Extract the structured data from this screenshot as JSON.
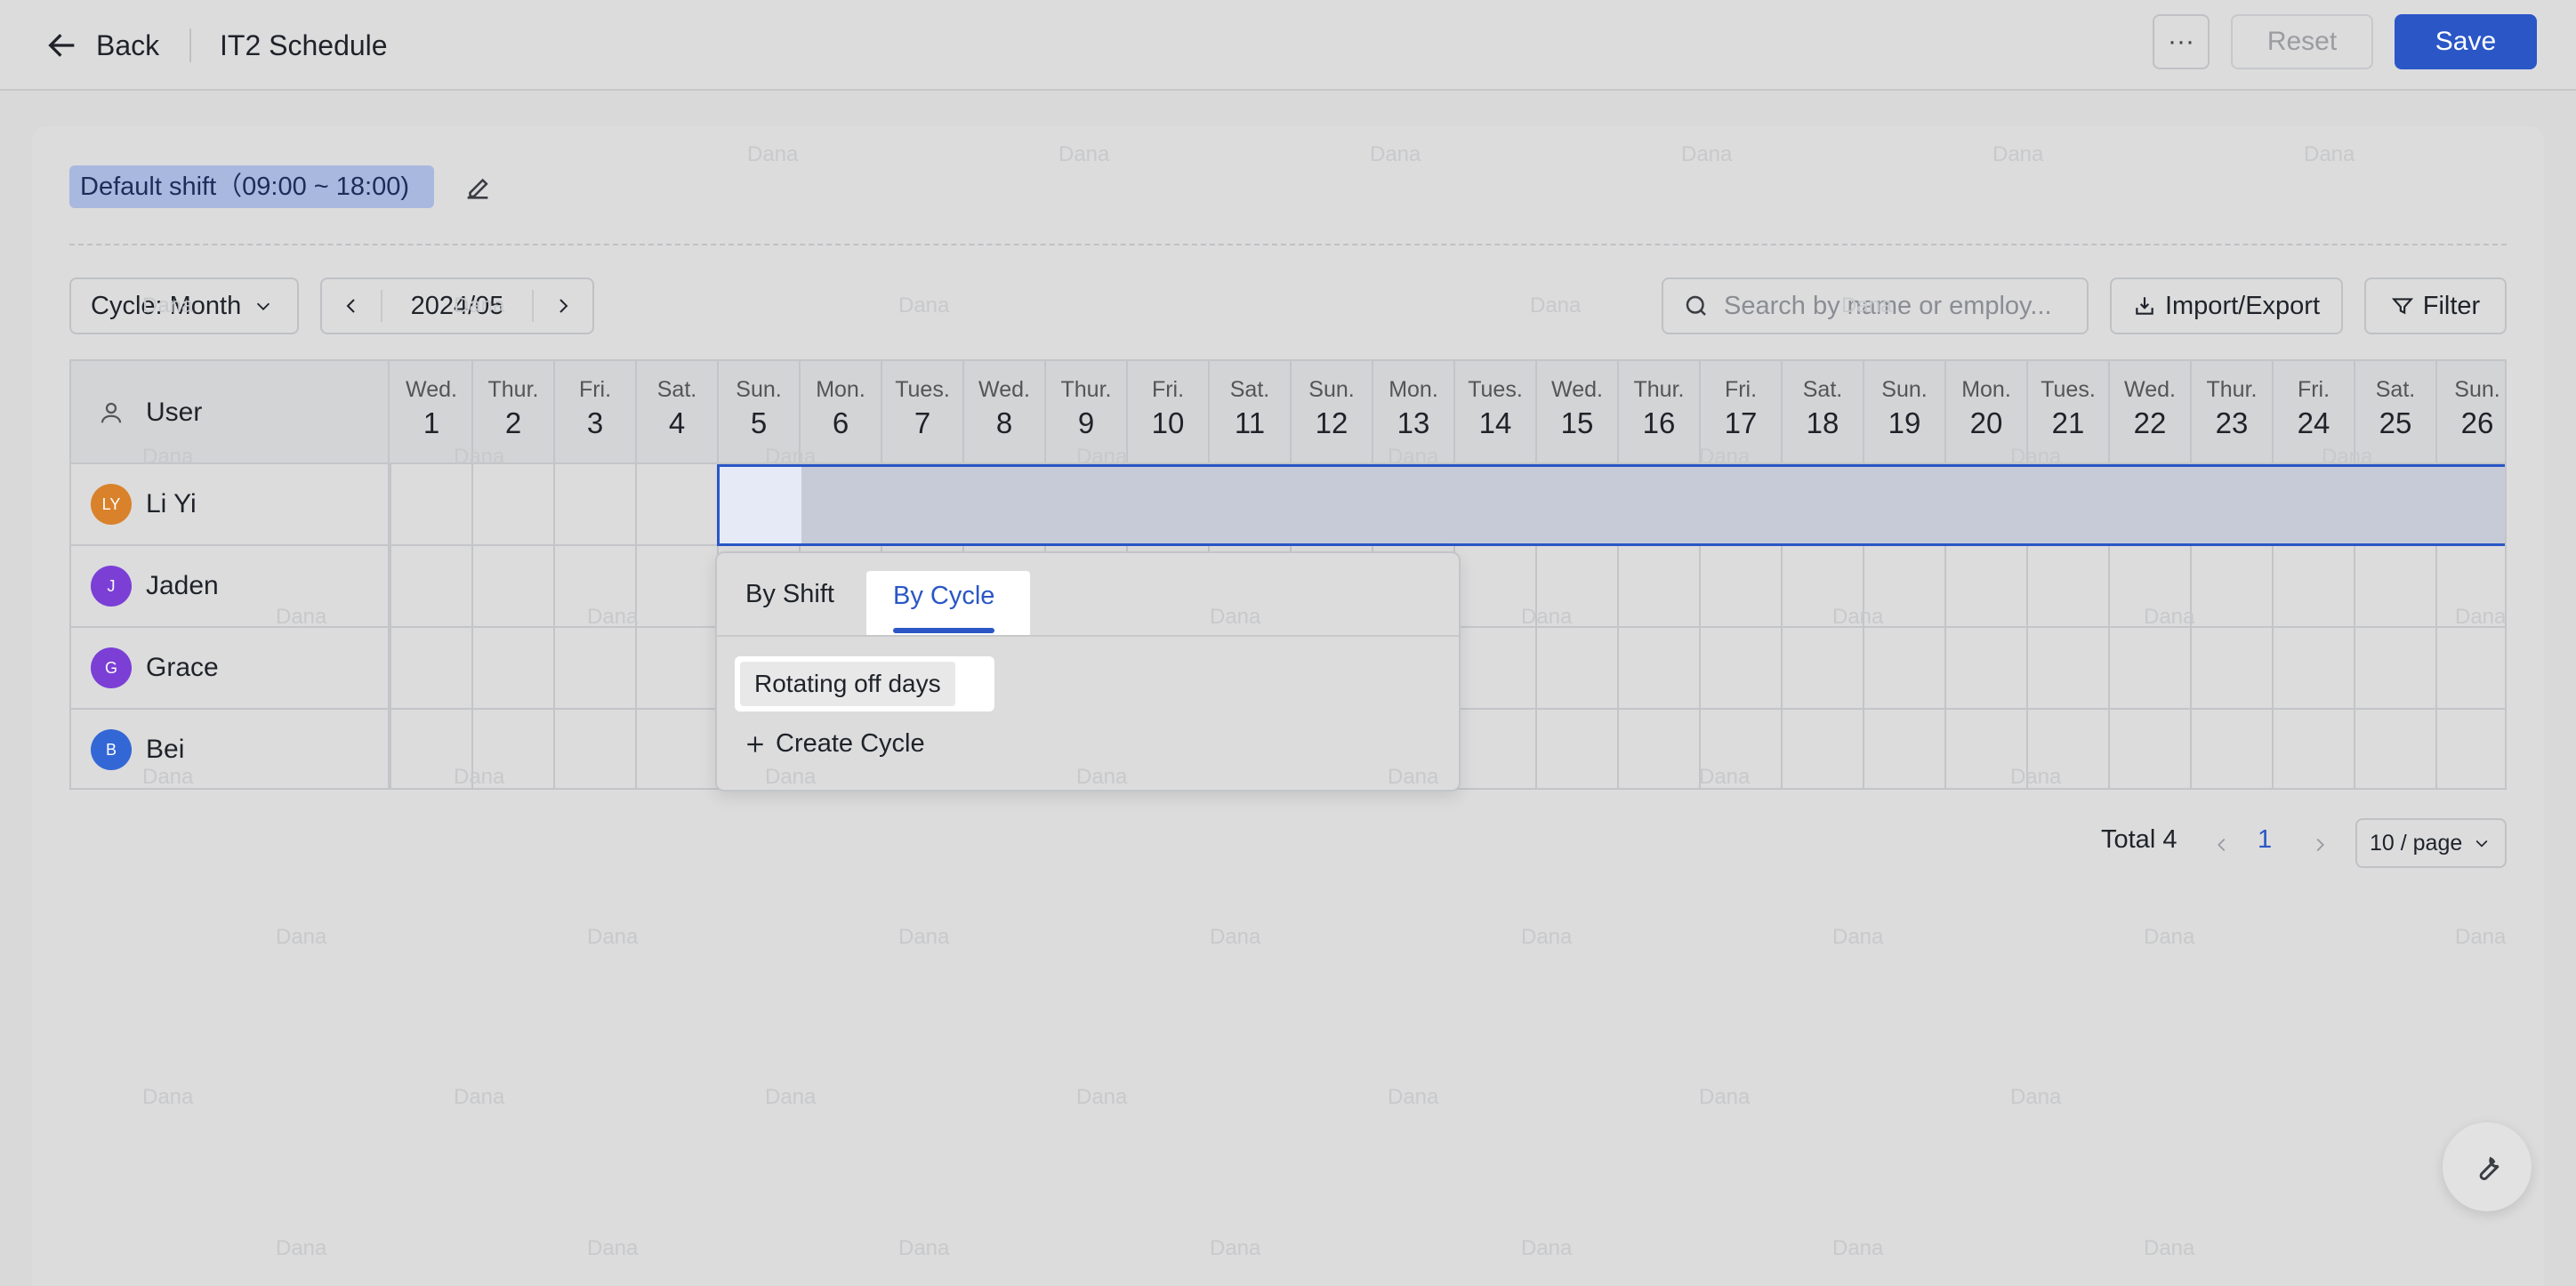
{
  "header": {
    "back_label": "Back",
    "title": "IT2 Schedule",
    "more_label": "···",
    "reset_label": "Reset",
    "save_label": "Save"
  },
  "shift": {
    "chip_label": "Default shift（09:00 ~ 18:00)"
  },
  "toolbar": {
    "cycle_label": "Cycle: Month",
    "date_value": "2024/05",
    "search_placeholder": "Search by name or employ...",
    "import_export_label": "Import/Export",
    "filter_label": "Filter"
  },
  "table": {
    "user_header": "User",
    "days": [
      {
        "dow": "Wed.",
        "num": "1"
      },
      {
        "dow": "Thur.",
        "num": "2"
      },
      {
        "dow": "Fri.",
        "num": "3"
      },
      {
        "dow": "Sat.",
        "num": "4"
      },
      {
        "dow": "Sun.",
        "num": "5"
      },
      {
        "dow": "Mon.",
        "num": "6"
      },
      {
        "dow": "Tues.",
        "num": "7"
      },
      {
        "dow": "Wed.",
        "num": "8"
      },
      {
        "dow": "Thur.",
        "num": "9"
      },
      {
        "dow": "Fri.",
        "num": "10"
      },
      {
        "dow": "Sat.",
        "num": "11"
      },
      {
        "dow": "Sun.",
        "num": "12"
      },
      {
        "dow": "Mon.",
        "num": "13"
      },
      {
        "dow": "Tues.",
        "num": "14"
      },
      {
        "dow": "Wed.",
        "num": "15"
      },
      {
        "dow": "Thur.",
        "num": "16"
      },
      {
        "dow": "Fri.",
        "num": "17"
      },
      {
        "dow": "Sat.",
        "num": "18"
      },
      {
        "dow": "Sun.",
        "num": "19"
      },
      {
        "dow": "Mon.",
        "num": "20"
      },
      {
        "dow": "Tues.",
        "num": "21"
      },
      {
        "dow": "Wed.",
        "num": "22"
      },
      {
        "dow": "Thur.",
        "num": "23"
      },
      {
        "dow": "Fri.",
        "num": "24"
      },
      {
        "dow": "Sat.",
        "num": "25"
      },
      {
        "dow": "Sun.",
        "num": "26"
      }
    ],
    "users": [
      {
        "initials": "LY",
        "name": "Li Yi",
        "color": "#d9822b"
      },
      {
        "initials": "J",
        "name": "Jaden",
        "color": "#7b3fd6"
      },
      {
        "initials": "G",
        "name": "Grace",
        "color": "#7b3fd6"
      },
      {
        "initials": "B",
        "name": "Bei",
        "color": "#3467d6"
      }
    ]
  },
  "popover": {
    "tab_shift": "By Shift",
    "tab_cycle": "By Cycle",
    "cycle_item": "Rotating off days",
    "create_label": "Create Cycle"
  },
  "pagination": {
    "total_label": "Total 4",
    "current_page": "1",
    "page_size": "10 / page"
  },
  "watermark": "Dana",
  "colors": {
    "accent": "#2a56c6",
    "chip_bg": "#a9b8de"
  }
}
